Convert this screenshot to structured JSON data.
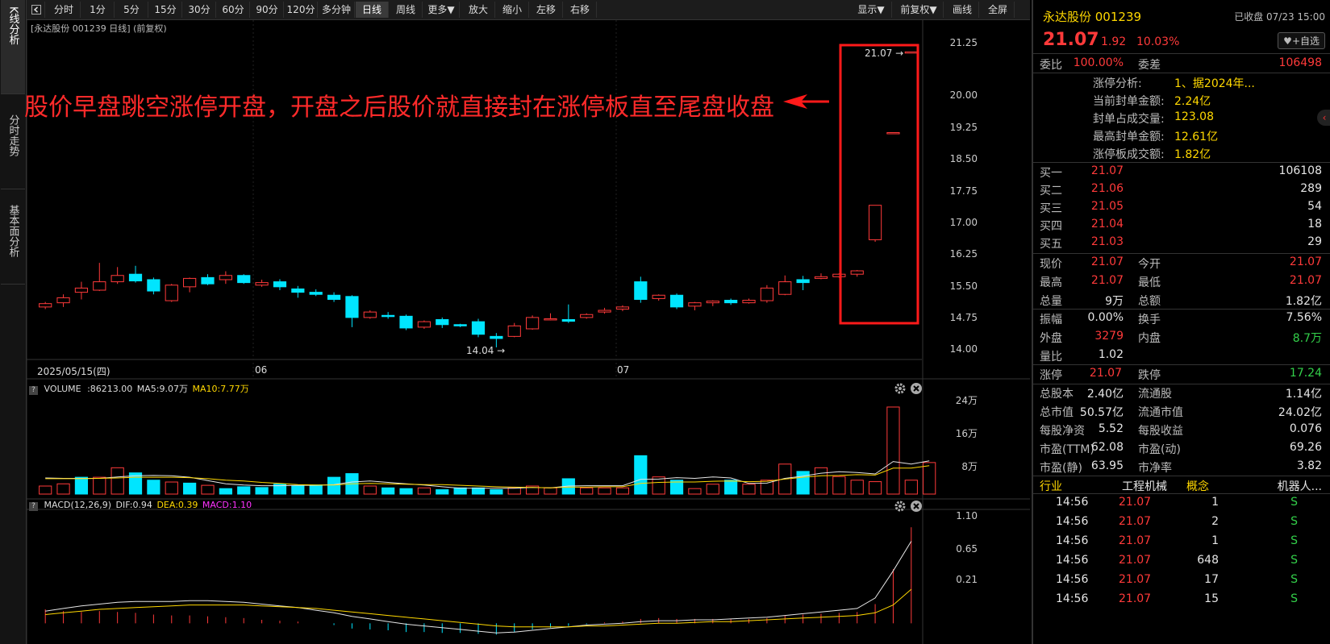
{
  "left_tabs": [
    "K线分析",
    "分时走势",
    "基本面分析"
  ],
  "toolbar": {
    "periods": [
      "分时",
      "1分",
      "5分",
      "15分",
      "30分",
      "60分",
      "90分",
      "120分",
      "多分钟",
      "日线",
      "周线",
      "更多▼"
    ],
    "actions": [
      "放大",
      "缩小",
      "左移",
      "右移"
    ],
    "right_actions": [
      "显示▼",
      "前复权▼",
      "画线",
      "全屏"
    ],
    "active_period": "日线"
  },
  "chart_header": "[永达股份 001239 日线]  (前复权)",
  "annotation": "股价早盘跳空涨停开盘，开盘之后股价就直接封在涨停板直至尾盘收盘",
  "price_labels": {
    "high": "21.07",
    "low": "14.04"
  },
  "date_labels": [
    "2025/05/15(四)",
    "06",
    "07"
  ],
  "colors": {
    "up": "#ff3a3a",
    "down": "#00e5ff",
    "ma_white": "#e6e6e6",
    "ma_yellow": "#ffd800",
    "box": "#ff1a1a"
  },
  "volume_header": {
    "q": "?",
    "name": "VOLUME",
    "value": ":86213.00",
    "ma5": "MA5:9.07万",
    "ma10": "MA10:7.77万"
  },
  "macd_header": {
    "q": "?",
    "name": "MACD(12,26,9)",
    "dif": "DIF:0.94",
    "dea": "DEA:0.39",
    "macd": "MACD:1.10"
  },
  "chart_data": [
    {
      "type": "candlestick",
      "title": "永达股份 001239 日线",
      "y_ticks": [
        "21.25",
        "20.00",
        "19.25",
        "18.50",
        "17.75",
        "17.00",
        "16.25",
        "15.50",
        "14.75",
        "14.00"
      ],
      "ylim": [
        14.0,
        21.25
      ],
      "ohlc": [
        [
          15.0,
          15.12,
          14.95,
          15.08
        ],
        [
          15.1,
          15.3,
          15.0,
          15.22
        ],
        [
          15.35,
          15.6,
          15.18,
          15.45
        ],
        [
          15.4,
          16.05,
          15.38,
          15.6
        ],
        [
          15.6,
          15.95,
          15.55,
          15.75
        ],
        [
          15.78,
          15.98,
          15.58,
          15.62
        ],
        [
          15.65,
          15.7,
          15.3,
          15.38
        ],
        [
          15.15,
          15.55,
          15.12,
          15.52
        ],
        [
          15.48,
          15.7,
          15.35,
          15.68
        ],
        [
          15.7,
          15.78,
          15.52,
          15.55
        ],
        [
          15.65,
          15.85,
          15.55,
          15.75
        ],
        [
          15.75,
          15.78,
          15.55,
          15.58
        ],
        [
          15.52,
          15.65,
          15.48,
          15.58
        ],
        [
          15.6,
          15.66,
          15.4,
          15.48
        ],
        [
          15.43,
          15.5,
          15.22,
          15.35
        ],
        [
          15.35,
          15.42,
          15.26,
          15.3
        ],
        [
          15.28,
          15.35,
          15.12,
          15.18
        ],
        [
          15.25,
          15.28,
          14.52,
          14.75
        ],
        [
          14.75,
          14.92,
          14.72,
          14.88
        ],
        [
          14.8,
          14.88,
          14.72,
          14.78
        ],
        [
          14.78,
          14.82,
          14.45,
          14.5
        ],
        [
          14.52,
          14.68,
          14.48,
          14.65
        ],
        [
          14.7,
          14.75,
          14.5,
          14.58
        ],
        [
          14.58,
          14.6,
          14.52,
          14.55
        ],
        [
          14.65,
          14.72,
          14.28,
          14.35
        ],
        [
          14.3,
          14.38,
          14.04,
          14.25
        ],
        [
          14.3,
          14.62,
          14.28,
          14.55
        ],
        [
          14.48,
          14.8,
          14.46,
          14.75
        ],
        [
          14.7,
          14.85,
          14.68,
          14.72
        ],
        [
          14.7,
          15.06,
          14.62,
          14.66
        ],
        [
          14.75,
          14.85,
          14.72,
          14.82
        ],
        [
          14.88,
          14.98,
          14.84,
          14.92
        ],
        [
          14.95,
          15.04,
          14.9,
          15.0
        ],
        [
          15.6,
          15.72,
          15.1,
          15.18
        ],
        [
          15.2,
          15.3,
          15.15,
          15.28
        ],
        [
          15.28,
          15.32,
          14.95,
          15.0
        ],
        [
          15.02,
          15.12,
          14.92,
          15.1
        ],
        [
          15.1,
          15.16,
          15.02,
          15.14
        ],
        [
          15.16,
          15.2,
          15.05,
          15.1
        ],
        [
          15.1,
          15.2,
          15.08,
          15.16
        ],
        [
          15.15,
          15.52,
          15.1,
          15.45
        ],
        [
          15.3,
          15.75,
          15.28,
          15.6
        ],
        [
          15.65,
          15.74,
          15.4,
          15.58
        ],
        [
          15.68,
          15.8,
          15.66,
          15.72
        ],
        [
          15.72,
          15.8,
          15.7,
          15.78
        ],
        [
          15.78,
          15.88,
          15.72,
          15.86
        ],
        [
          16.6,
          17.42,
          16.55,
          17.42
        ],
        [
          19.15,
          19.15,
          19.15,
          19.15
        ],
        [
          21.07,
          21.07,
          21.07,
          21.07
        ]
      ]
    },
    {
      "type": "bar",
      "title": "VOLUME",
      "y_ticks": [
        "24万",
        "16万",
        "8万"
      ],
      "ylim": [
        0,
        26
      ],
      "values": [
        2.2,
        2.8,
        4.6,
        4.6,
        7.2,
        5.8,
        3.8,
        3.3,
        3.0,
        2.4,
        1.5,
        2.0,
        1.8,
        2.7,
        2.2,
        2.5,
        4.6,
        5.6,
        2.2,
        1.7,
        1.5,
        1.7,
        1.2,
        1.7,
        1.7,
        1.2,
        1.7,
        2.2,
        1.7,
        4.2,
        1.7,
        1.7,
        1.7,
        10.5,
        4.7,
        3.8,
        1.5,
        2.7,
        3.8,
        2.7,
        3.8,
        8.2,
        6.2,
        7.2,
        4.8,
        3.8,
        3.4,
        23.8,
        3.8,
        8.62
      ],
      "up": [
        1,
        1,
        0,
        1,
        1,
        0,
        0,
        1,
        0,
        1,
        0,
        0,
        0,
        0,
        0,
        0,
        0,
        0,
        1,
        0,
        0,
        1,
        0,
        0,
        0,
        0,
        1,
        1,
        1,
        0,
        1,
        1,
        1,
        0,
        1,
        0,
        1,
        1,
        0,
        1,
        1,
        1,
        0,
        1,
        1,
        1,
        1,
        1,
        1,
        1
      ],
      "series": [
        {
          "name": "MA5",
          "values": [
            4.4,
            4.3,
            4.3,
            4.3,
            4.7,
            5.0,
            5.1,
            5.0,
            4.6,
            3.7,
            2.8,
            2.5,
            2.3,
            2.3,
            2.4,
            2.4,
            2.6,
            3.3,
            3.6,
            3.2,
            2.8,
            2.5,
            2.0,
            1.6,
            1.6,
            1.6,
            1.6,
            1.8,
            1.7,
            2.2,
            2.3,
            2.3,
            2.3,
            4.0,
            4.1,
            4.5,
            4.3,
            4.7,
            4.4,
            2.9,
            3.0,
            4.3,
            4.9,
            5.7,
            6.1,
            5.9,
            5.5,
            8.9,
            8.2,
            9.07
          ]
        },
        {
          "name": "MA10",
          "values": [
            4.2,
            4.2,
            4.2,
            4.3,
            4.4,
            4.6,
            4.6,
            4.6,
            4.5,
            4.2,
            3.8,
            3.6,
            3.2,
            2.9,
            2.6,
            2.5,
            2.5,
            2.8,
            2.9,
            2.8,
            2.7,
            2.6,
            2.6,
            2.4,
            2.2,
            2.0,
            1.9,
            1.8,
            1.7,
            1.9,
            1.9,
            2.0,
            2.0,
            2.9,
            3.2,
            3.3,
            3.3,
            3.5,
            3.6,
            3.4,
            3.5,
            4.1,
            4.6,
            5.0,
            5.1,
            5.3,
            5.2,
            7.1,
            7.1,
            7.77
          ]
        }
      ]
    },
    {
      "type": "bar",
      "title": "MACD(12,26,9)",
      "y_ticks": [
        "1.10",
        "0.65",
        "0.21"
      ],
      "ylim": [
        -0.2,
        1.24
      ],
      "values": [
        0.16,
        0.14,
        0.13,
        0.14,
        0.13,
        0.12,
        0.1,
        0.09,
        0.09,
        0.08,
        0.07,
        0.06,
        0.04,
        0.03,
        0.02,
        0.0,
        -0.02,
        -0.06,
        -0.07,
        -0.08,
        -0.1,
        -0.1,
        -0.11,
        -0.11,
        -0.12,
        -0.13,
        -0.1,
        -0.07,
        -0.05,
        -0.03,
        -0.01,
        0.01,
        0.02,
        0.05,
        0.06,
        0.05,
        0.05,
        0.05,
        0.05,
        0.05,
        0.06,
        0.09,
        0.1,
        0.11,
        0.12,
        0.13,
        0.22,
        0.62,
        1.1
      ],
      "series": [
        {
          "name": "DIF",
          "values": [
            0.14,
            0.17,
            0.2,
            0.22,
            0.24,
            0.25,
            0.25,
            0.25,
            0.26,
            0.26,
            0.25,
            0.24,
            0.22,
            0.2,
            0.18,
            0.15,
            0.12,
            0.08,
            0.05,
            0.02,
            -0.01,
            -0.03,
            -0.05,
            -0.07,
            -0.09,
            -0.11,
            -0.1,
            -0.08,
            -0.06,
            -0.04,
            -0.02,
            -0.01,
            0.0,
            0.02,
            0.03,
            0.03,
            0.04,
            0.04,
            0.05,
            0.06,
            0.07,
            0.09,
            0.11,
            0.13,
            0.15,
            0.17,
            0.29,
            0.6,
            0.94
          ]
        },
        {
          "name": "DEA",
          "values": [
            0.1,
            0.12,
            0.14,
            0.16,
            0.17,
            0.18,
            0.19,
            0.2,
            0.21,
            0.21,
            0.21,
            0.21,
            0.2,
            0.19,
            0.18,
            0.17,
            0.15,
            0.13,
            0.11,
            0.09,
            0.07,
            0.05,
            0.03,
            0.01,
            -0.01,
            -0.03,
            -0.04,
            -0.04,
            -0.04,
            -0.04,
            -0.03,
            -0.03,
            -0.02,
            -0.01,
            0.0,
            0.0,
            0.01,
            0.02,
            0.02,
            0.03,
            0.04,
            0.05,
            0.06,
            0.07,
            0.08,
            0.09,
            0.12,
            0.21,
            0.39
          ]
        }
      ]
    }
  ],
  "right_panel": {
    "stock_name": "永达股份 001239",
    "status": "已收盘 07/23 15:00",
    "price": "21.07",
    "change": "1.92",
    "change_pct": "10.03%",
    "watch_button": "+自选",
    "weibi_label": "委比",
    "weibi": "100.00%",
    "weicha_label": "委差",
    "weicha": "106498",
    "limit_analysis": [
      {
        "label": "涨停分析:",
        "value": "1、据2024年..."
      },
      {
        "label": "当前封单金额:",
        "value": "2.24亿"
      },
      {
        "label": "封单占成交量:",
        "value": "123.08"
      },
      {
        "label": "最高封单金额:",
        "value": "12.61亿"
      },
      {
        "label": "涨停板成交额:",
        "value": "1.82亿"
      }
    ],
    "bids": [
      {
        "label": "买一",
        "price": "21.07",
        "vol": "106108"
      },
      {
        "label": "买二",
        "price": "21.06",
        "vol": "289"
      },
      {
        "label": "买三",
        "price": "21.05",
        "vol": "54"
      },
      {
        "label": "买四",
        "price": "21.04",
        "vol": "18"
      },
      {
        "label": "买五",
        "price": "21.03",
        "vol": "29"
      }
    ],
    "quote": [
      {
        "l1": "现价",
        "v1": "21.07",
        "c1": "red",
        "l2": "今开",
        "v2": "21.07",
        "c2": "red"
      },
      {
        "l1": "最高",
        "v1": "21.07",
        "c1": "red",
        "l2": "最低",
        "v2": "21.07",
        "c2": "red"
      },
      {
        "l1": "总量",
        "v1": "9万",
        "c1": "white",
        "l2": "总额",
        "v2": "1.82亿",
        "c2": "white"
      }
    ],
    "stats": [
      {
        "l1": "振幅",
        "v1": "0.00%",
        "c1": "white",
        "l2": "换手",
        "v2": "7.56%",
        "c2": "white"
      },
      {
        "l1": "外盘",
        "v1": "3279",
        "c1": "red",
        "l2": "内盘",
        "v2": "8.7万",
        "c2": "green"
      },
      {
        "l1": "量比",
        "v1": "1.02",
        "c1": "white",
        "l2": "",
        "v2": "",
        "c2": "white"
      }
    ],
    "limit": {
      "up_label": "涨停",
      "up": "21.07",
      "down_label": "跌停",
      "down": "17.24"
    },
    "fundamentals": [
      {
        "l1": "总股本",
        "v1": "2.40亿",
        "l2": "流通股",
        "v2": "1.14亿"
      },
      {
        "l1": "总市值",
        "v1": "50.57亿",
        "l2": "流通市值",
        "v2": "24.02亿"
      },
      {
        "l1": "每股净资",
        "v1": "5.52",
        "l2": "每股收益",
        "v2": "0.076"
      },
      {
        "l1": "市盈(TTM)",
        "v1": "62.08",
        "l2": "市盈(动)",
        "v2": "69.26"
      },
      {
        "l1": "市盈(静)",
        "v1": "63.95",
        "l2": "市净率",
        "v2": "3.82"
      }
    ],
    "industry": {
      "l1": "行业",
      "v1": "工程机械",
      "l2": "概念",
      "v2": "机器人..."
    },
    "trades": [
      {
        "time": "14:56",
        "price": "21.07",
        "vol": "1",
        "side": "S"
      },
      {
        "time": "14:56",
        "price": "21.07",
        "vol": "2",
        "side": "S"
      },
      {
        "time": "14:56",
        "price": "21.07",
        "vol": "1",
        "side": "S"
      },
      {
        "time": "14:56",
        "price": "21.07",
        "vol": "648",
        "side": "S"
      },
      {
        "time": "14:56",
        "price": "21.07",
        "vol": "17",
        "side": "S"
      },
      {
        "time": "14:56",
        "price": "21.07",
        "vol": "15",
        "side": "S"
      }
    ]
  }
}
